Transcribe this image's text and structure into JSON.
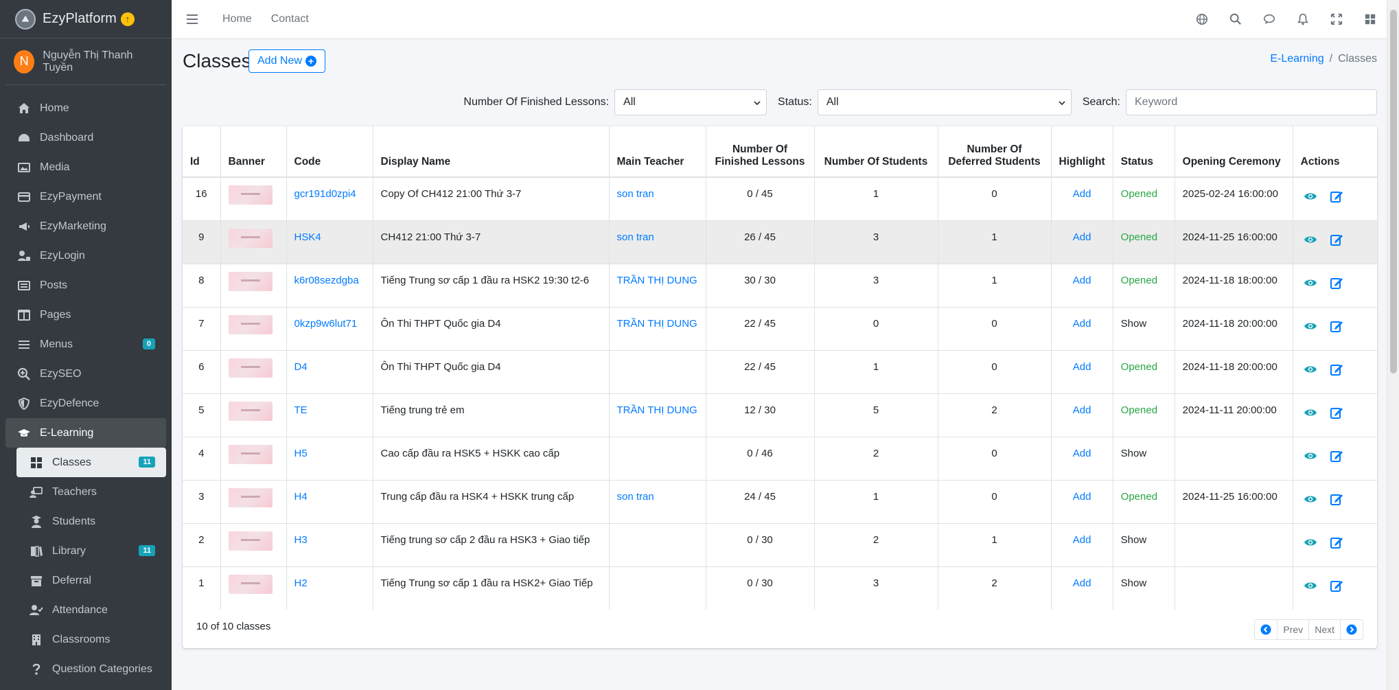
{
  "brand": {
    "name": "EzyPlatform",
    "upgrade_glyph": "↑"
  },
  "user": {
    "initial": "N",
    "name": "Nguyễn Thị Thanh Tuyền"
  },
  "sidebar": {
    "items": [
      {
        "label": "Home",
        "icon": "home-icon"
      },
      {
        "label": "Dashboard",
        "icon": "dashboard-icon"
      },
      {
        "label": "Media",
        "icon": "image-icon"
      },
      {
        "label": "EzyPayment",
        "icon": "credit-card-icon"
      },
      {
        "label": "EzyMarketing",
        "icon": "bullhorn-icon"
      },
      {
        "label": "EzyLogin",
        "icon": "user-lock-icon"
      },
      {
        "label": "Posts",
        "icon": "newspaper-icon"
      },
      {
        "label": "Pages",
        "icon": "columns-icon"
      },
      {
        "label": "Menus",
        "icon": "bars-icon",
        "badge": "0"
      },
      {
        "label": "EzySEO",
        "icon": "search-plus-icon"
      },
      {
        "label": "EzyDefence",
        "icon": "shield-icon"
      },
      {
        "label": "E-Learning",
        "icon": "graduation-cap-icon"
      }
    ],
    "sub_items": [
      {
        "label": "Classes",
        "icon": "grid-icon",
        "badge": "11"
      },
      {
        "label": "Teachers",
        "icon": "chalkboard-teacher-icon"
      },
      {
        "label": "Students",
        "icon": "user-graduate-icon"
      },
      {
        "label": "Library",
        "icon": "book-icon",
        "badge": "11"
      },
      {
        "label": "Deferral",
        "icon": "archive-icon"
      },
      {
        "label": "Attendance",
        "icon": "user-check-icon"
      },
      {
        "label": "Classrooms",
        "icon": "building-icon"
      },
      {
        "label": "Question Categories",
        "icon": "question-icon"
      }
    ]
  },
  "topbar": {
    "links": [
      "Home",
      "Contact"
    ]
  },
  "page": {
    "title": "Classes",
    "add_new_label": "Add New",
    "add_glyph": "+"
  },
  "breadcrumb": {
    "parent": "E-Learning",
    "sep": "/",
    "current": "Classes"
  },
  "filters": {
    "finished_label": "Number Of Finished Lessons:",
    "finished_value": "All",
    "status_label": "Status:",
    "status_value": "All",
    "search_label": "Search:",
    "search_placeholder": "Keyword"
  },
  "table": {
    "headers": {
      "id": "Id",
      "banner": "Banner",
      "code": "Code",
      "display_name": "Display Name",
      "main_teacher": "Main Teacher",
      "finished_1": "Number Of",
      "finished_2": "Finished Lessons",
      "students": "Number Of Students",
      "deferred_1": "Number Of",
      "deferred_2": "Deferred Students",
      "highlight": "Highlight",
      "status": "Status",
      "opening": "Opening Ceremony",
      "actions": "Actions"
    },
    "rows": [
      {
        "id": "16",
        "code": "gcr191d0zpi4",
        "name": "Copy Of CH412 21:00 Thứ 3-7",
        "teacher": "son tran",
        "finished": "0 / 45",
        "students": "1",
        "deferred": "0",
        "highlight": "Add",
        "status": "Opened",
        "opening": "2025-02-24 16:00:00"
      },
      {
        "id": "9",
        "code": "HSK4",
        "name": "CH412 21:00 Thứ 3-7",
        "teacher": "son tran",
        "finished": "26 / 45",
        "students": "3",
        "deferred": "1",
        "highlight": "Add",
        "status": "Opened",
        "opening": "2024-11-25 16:00:00"
      },
      {
        "id": "8",
        "code": "k6r08sezdgba",
        "name": "Tiếng Trung sơ cấp 1 đầu ra HSK2 19:30 t2-6",
        "teacher": "TRẦN THỊ DUNG",
        "finished": "30 / 30",
        "students": "3",
        "deferred": "1",
        "highlight": "Add",
        "status": "Opened",
        "opening": "2024-11-18 18:00:00"
      },
      {
        "id": "7",
        "code": "0kzp9w6lut71",
        "name": "Ôn Thi THPT Quốc gia D4",
        "teacher": "TRẦN THỊ DUNG",
        "finished": "22 / 45",
        "students": "0",
        "deferred": "0",
        "highlight": "Add",
        "status": "Show",
        "opening": "2024-11-18 20:00:00"
      },
      {
        "id": "6",
        "code": "D4",
        "name": "Ôn Thi THPT Quốc gia D4",
        "teacher": "",
        "finished": "22 / 45",
        "students": "1",
        "deferred": "0",
        "highlight": "Add",
        "status": "Opened",
        "opening": "2024-11-18 20:00:00"
      },
      {
        "id": "5",
        "code": "TE",
        "name": "Tiếng trung trẻ em",
        "teacher": "TRẦN THỊ DUNG",
        "finished": "12 / 30",
        "students": "5",
        "deferred": "2",
        "highlight": "Add",
        "status": "Opened",
        "opening": "2024-11-11 20:00:00"
      },
      {
        "id": "4",
        "code": "H5",
        "name": "Cao cấp đầu ra HSK5 + HSKK cao cấp",
        "teacher": "",
        "finished": "0 / 46",
        "students": "2",
        "deferred": "0",
        "highlight": "Add",
        "status": "Show",
        "opening": ""
      },
      {
        "id": "3",
        "code": "H4",
        "name": "Trung cấp đầu ra HSK4 + HSKK trung cấp",
        "teacher": "son tran",
        "finished": "24 / 45",
        "students": "1",
        "deferred": "0",
        "highlight": "Add",
        "status": "Opened",
        "opening": "2024-11-25 16:00:00"
      },
      {
        "id": "2",
        "code": "H3",
        "name": "Tiếng trung sơ cấp 2 đầu ra HSK3 + Giao tiếp",
        "teacher": "",
        "finished": "0 / 30",
        "students": "2",
        "deferred": "1",
        "highlight": "Add",
        "status": "Show",
        "opening": ""
      },
      {
        "id": "1",
        "code": "H2",
        "name": "Tiếng Trung sơ cấp 1 đầu ra HSK2+ Giao Tiếp",
        "teacher": "",
        "finished": "0 / 30",
        "students": "3",
        "deferred": "2",
        "highlight": "Add",
        "status": "Show",
        "opening": ""
      }
    ]
  },
  "footer": {
    "count_text": "10 of 10 classes",
    "prev_label": "Prev",
    "next_label": "Next"
  },
  "colors": {
    "sidebar_bg": "#343a40",
    "link": "#007bff",
    "opened": "#28a745",
    "badge": "#17a2b8",
    "action_icon": "#17a2b8",
    "edit_icon": "#007bff"
  }
}
